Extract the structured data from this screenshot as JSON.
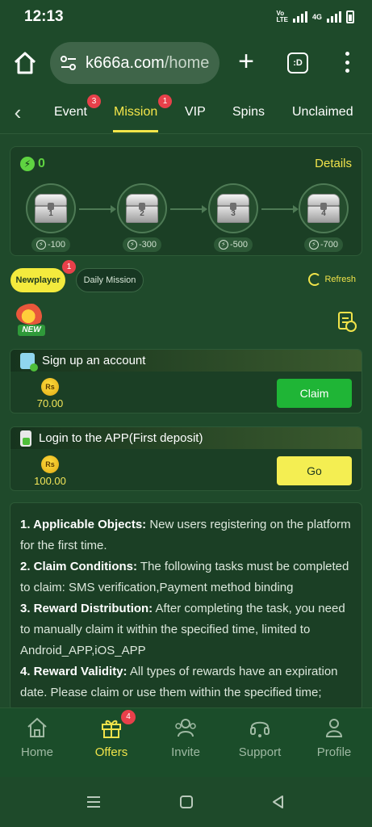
{
  "status_bar": {
    "time": "12:13",
    "net_label_1": "Vo\nLTE",
    "net_label_2": "4G"
  },
  "browser": {
    "url_host": "k666a.com",
    "url_path": "/home",
    "tab_count": ":D"
  },
  "tabs": [
    {
      "label": "Event",
      "badge": "3",
      "active": false
    },
    {
      "label": "Mission",
      "badge": "1",
      "active": true
    },
    {
      "label": "VIP",
      "badge": "",
      "active": false
    },
    {
      "label": "Spins",
      "badge": "",
      "active": false
    },
    {
      "label": "Unclaimed",
      "badge": "",
      "active": false
    }
  ],
  "progress": {
    "energy": "0",
    "details_label": "Details",
    "chests": [
      {
        "num": "1",
        "reward": "-100"
      },
      {
        "num": "2",
        "reward": "-300"
      },
      {
        "num": "3",
        "reward": "-500"
      },
      {
        "num": "4",
        "reward": "-700"
      }
    ]
  },
  "filters": {
    "newplayer": "Newplayer",
    "newplayer_badge": "1",
    "daily": "Daily Mission",
    "refresh": "Refresh"
  },
  "logo": {
    "new_tag": "NEW"
  },
  "tasks": [
    {
      "title": "Sign up an account",
      "currency": "Rs",
      "amount": "70.00",
      "button": "Claim"
    },
    {
      "title": "Login to the APP(First deposit)",
      "currency": "Rs",
      "amount": "100.00",
      "button": "Go"
    }
  ],
  "rules": [
    {
      "head": "1. Applicable Objects:",
      "body": " New users registering on the platform for the first time."
    },
    {
      "head": "2. Claim Conditions:",
      "body": " The following tasks must be completed to claim: SMS verification,Payment method binding"
    },
    {
      "head": "3. Reward Distribution:",
      "body": " After completing the task, you need to manually claim it within the specified time, limited to Android_APP,iOS_APP"
    },
    {
      "head": "4. Reward Validity:",
      "body": " All types of rewards have an expiration date. Please claim or use them within the specified time;"
    }
  ],
  "bottom_nav": [
    {
      "label": "Home",
      "icon": "home-icon",
      "active": false,
      "badge": ""
    },
    {
      "label": "Offers",
      "icon": "gift-icon",
      "active": true,
      "badge": "4"
    },
    {
      "label": "Invite",
      "icon": "people-icon",
      "active": false,
      "badge": ""
    },
    {
      "label": "Support",
      "icon": "headset-icon",
      "active": false,
      "badge": ""
    },
    {
      "label": "Profile",
      "icon": "person-icon",
      "active": false,
      "badge": ""
    }
  ],
  "colors": {
    "accent_yellow": "#f0e34a",
    "green_button": "#1fb536",
    "background": "#1f4a2b",
    "badge_red": "#e8404a"
  }
}
